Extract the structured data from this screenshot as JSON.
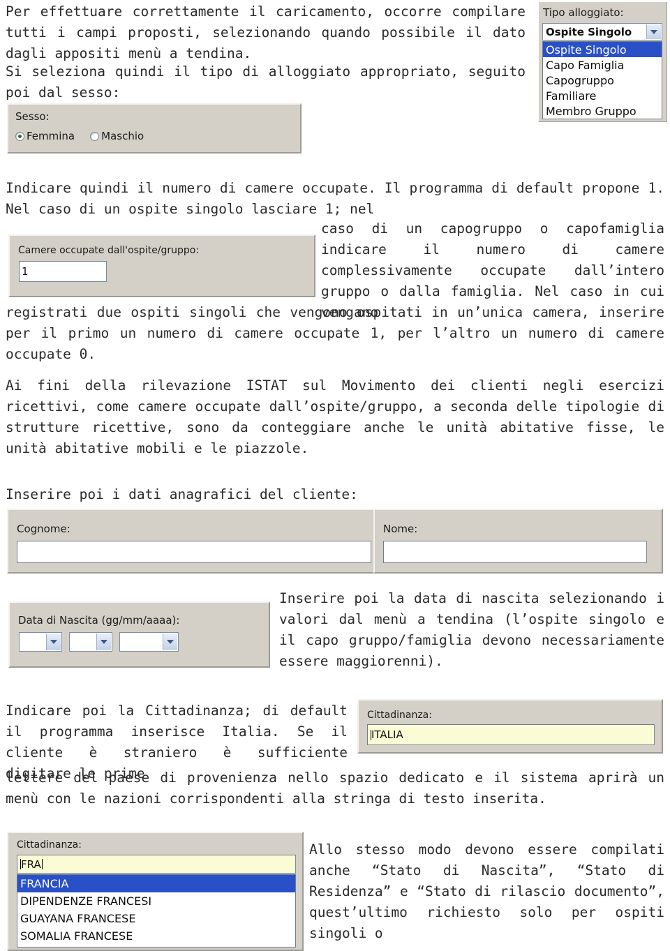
{
  "document": {
    "paragraphs": {
      "intro": "Per effettuare correttamente il caricamento, occorre compilare tutti i campi proposti, selezionando quando possibile il dato dagli appositi menù a tendina.",
      "intro2": "Si seleziona quindi il tipo di alloggiato appropriato, seguito poi dal sesso:",
      "rooms_lead": "Indicare quindi il numero di camere occupate. Il programma di default propone 1. Nel caso di un ospite singolo lasciare 1; nel",
      "rooms_wrap": "caso di un capogruppo o capofamiglia indicare il numero di camere complessivamente occupate dall’intero gruppo o dalla famiglia. Nel caso in cui vengano",
      "rooms_tail": "registrati due ospiti singoli che vengono ospitati in un’unica camera, inserire per il primo un numero di camere occupate 1, per l’altro un numero di camere occupate 0.",
      "istat": "Ai fini della rilevazione ISTAT sul Movimento dei clienti negli esercizi ricettivi, come camere occupate dall’ospite/gruppo, a seconda delle tipologie di strutture ricettive, sono da conteggiare anche le unità abitative fisse, le unità abitative mobili e le piazzole.",
      "anagrafici": "Inserire poi i dati anagrafici del cliente:",
      "birthdate": "Inserire poi la data di nascita selezionando i valori dal menù a tendina (l’ospite singolo e il capo gruppo/famiglia devono necessariamente essere maggiorenni).",
      "citizenship_lead": "Indicare poi la Cittadinanza; di default il programma inserisce Italia. Se il cliente è straniero è sufficiente digitare le prime",
      "citizenship_tail": "lettere del paese di provenienza nello spazio dedicato e il sistema aprirà un menù con le nazioni corrispondenti alla stringa di testo inserita.",
      "states": "Allo stesso modo devono essere compilati anche “Stato di Nascita”, “Stato di Residenza” e “Stato di rilascio documento”, quest’ultimo richiesto solo per ospiti singoli o"
    }
  },
  "tipo_alloggiato": {
    "label": "Tipo alloggiato:",
    "selected_value": "Ospite Singolo",
    "options": [
      "Ospite Singolo",
      "Capo Famiglia",
      "Capogruppo",
      "Familiare",
      "Membro Gruppo"
    ],
    "highlighted_index": 0
  },
  "sesso": {
    "label": "Sesso:",
    "options": [
      {
        "label": "Femmina",
        "selected": true
      },
      {
        "label": "Maschio",
        "selected": false
      }
    ]
  },
  "camere": {
    "label": "Camere occupate dall'ospite/gruppo:",
    "value": "1"
  },
  "anagrafica": {
    "cognome_label": "Cognome:",
    "cognome_value": "",
    "nome_label": "Nome:",
    "nome_value": ""
  },
  "data_nascita": {
    "label": "Data di Nascita (gg/mm/aaaa):",
    "day_value": "",
    "month_value": "",
    "year_value": ""
  },
  "cittadinanza_italia": {
    "label": "Cittadinanza:",
    "value": "ITALIA"
  },
  "cittadinanza_fra": {
    "label": "Cittadinanza:",
    "value": "FRA",
    "suggestions": [
      "FRANCIA",
      "DIPENDENZE FRANCESI",
      "GUAYANA FRANCESE",
      "SOMALIA FRANCESE"
    ],
    "highlighted_index": 0
  },
  "colors": {
    "widget_face": "#d4d0c8",
    "highlight_blue": "#2a50c8",
    "field_yellow": "#fbfbd6",
    "radio_dot_green": "#2f6b2f"
  }
}
